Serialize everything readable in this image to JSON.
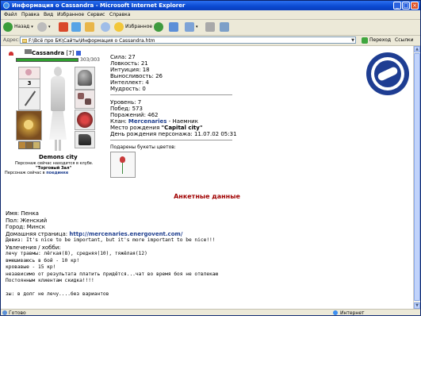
{
  "window": {
    "title": "Информация о Cassandra - Microsoft Internet Explorer"
  },
  "menu": [
    "Файл",
    "Правка",
    "Вид",
    "Избранное",
    "Сервис",
    "Справка"
  ],
  "toolbar": {
    "back": "Назад",
    "favorites": "Избранное"
  },
  "address": {
    "label": "Адрес:",
    "url": "F:\\Всё про БК\\Сайты\\Информация о Cassandra.htm",
    "go": "Переход",
    "links": "Ссылки"
  },
  "char": {
    "name": "Cassandra",
    "level": "[7]",
    "hp": "303/303",
    "city": "Demons city",
    "location_line": "Персонаж сейчас находится в клубе.",
    "room": "\"Торговый Зал\"",
    "fight_prefix": "Персонаж сейчас в",
    "fight_link": "поединке",
    "slot_number": "3"
  },
  "stats": {
    "strength": "Сила: 27",
    "agility": "Ловкость: 21",
    "intuition": "Интуиция: 18",
    "endurance": "Выносливость: 26",
    "intellect": "Интеллект: 4",
    "wisdom": "Мудрость: 0",
    "level": "Уровень: 7",
    "wins": "Побед: 573",
    "losses": "Поражений: 462",
    "clan_label": "Клан:",
    "clan_name": "Mercenaries",
    "clan_rank": "- Наемник",
    "birthplace_label": "Место рождения",
    "birthplace": "\"Capital city\"",
    "birthday": "День рождения персонажа: 11.07.02 05:31",
    "flowers": "Подарены букеты цветов:"
  },
  "profile": {
    "heading": "Анкетные данные",
    "name": "Имя: Пенка",
    "gender": "Пол: Женский",
    "city": "Город: Минск",
    "homepage_label": "Домашняя страница:",
    "homepage": "http://mercenaries.energovent.com/",
    "motto": "Девиз: It's nice to be important, but it's more important to be nice!!!",
    "hobby_label": "Увлечения / хобби:",
    "hobby_lines": [
      "лечу травмы: лёгкая(8), средняя(10), тяжёлая(12)",
      "вмешиваюсь в бой - 10 кр!",
      "кровавые - 15 кр!",
      "независимо от результата платить придётся...чат во время боя не отвлекаю",
      "Постоянным клиентам скидка!!!!",
      "",
      "зы: в долг не лечу....без вариантов"
    ]
  },
  "status": {
    "ready": "Готово",
    "zone": "Интернет"
  },
  "colors": {
    "heading": "#a00000",
    "link": "#1f3f8f",
    "hp_bar": "#2ea02e",
    "titlebar": "#0a49d0"
  }
}
